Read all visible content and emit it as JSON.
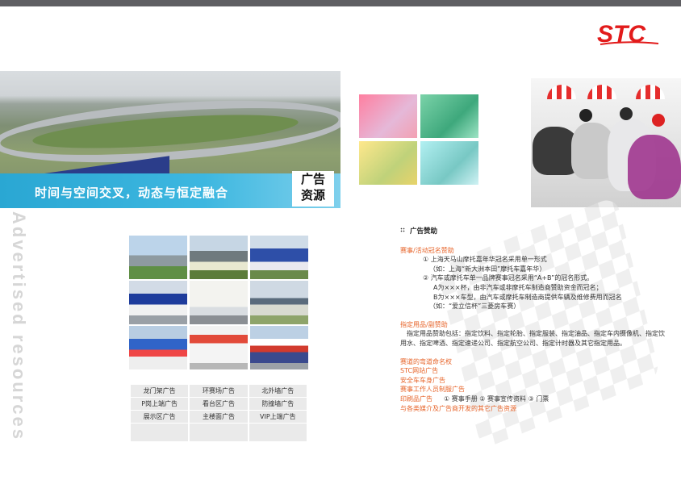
{
  "logo": {
    "text": "STC",
    "color": "#e21b1b"
  },
  "hero": {
    "slogan": "时间与空间交叉，动态与恒定融合",
    "tag_line1": "广告",
    "tag_line2": "资源"
  },
  "side_title": "Advertised resources",
  "ad_table": {
    "rows": [
      [
        "龙门架广告",
        "环赛场广告",
        "北外墙广告"
      ],
      [
        "P岗上端广告",
        "看台区广告",
        "防撞墙广告"
      ],
      [
        "展示区广告",
        "主楼面广告",
        "VIP上端广告"
      ]
    ]
  },
  "sponsorship": {
    "heading": "广告赞助",
    "title_sponsor": {
      "title": "赛事/活动冠名赞助",
      "lines": [
        "① 上海天马山摩托嘉年华冠名采用单一形式",
        "（如：上海“新大洲本田”摩托车嘉年华）",
        "② 汽车或摩托车单一品牌赛事冠名采用“A+B”的冠名形式。",
        "A为×××杯，由非汽车或非摩托车制造商赞助资金而冠名；",
        "B为×××车型，由汽车或摩托车制造商提供车辆及维修费用而冠名",
        "（如：“爱立信杯”三菱房车赛）"
      ]
    },
    "designated": {
      "title": "指定用品/副赞助",
      "text": "指定用品赞助包括：指定饮料、指定轮胎、指定服装、指定油品、指定车内摄像机、指定饮用水、指定啤酒、指定速递公司、指定航空公司、指定计时器及其它指定用品。"
    },
    "others": [
      "赛道的弯道命名权",
      "STC网站广告",
      "安全车车身广告",
      "赛事工作人员制服广告"
    ],
    "print": {
      "label": "印刷品广告",
      "items": "① 赛事手册  ② 赛事宣传资料  ③ 门票"
    },
    "media": "与各类媒介及广告商开发的其它广告资源"
  }
}
